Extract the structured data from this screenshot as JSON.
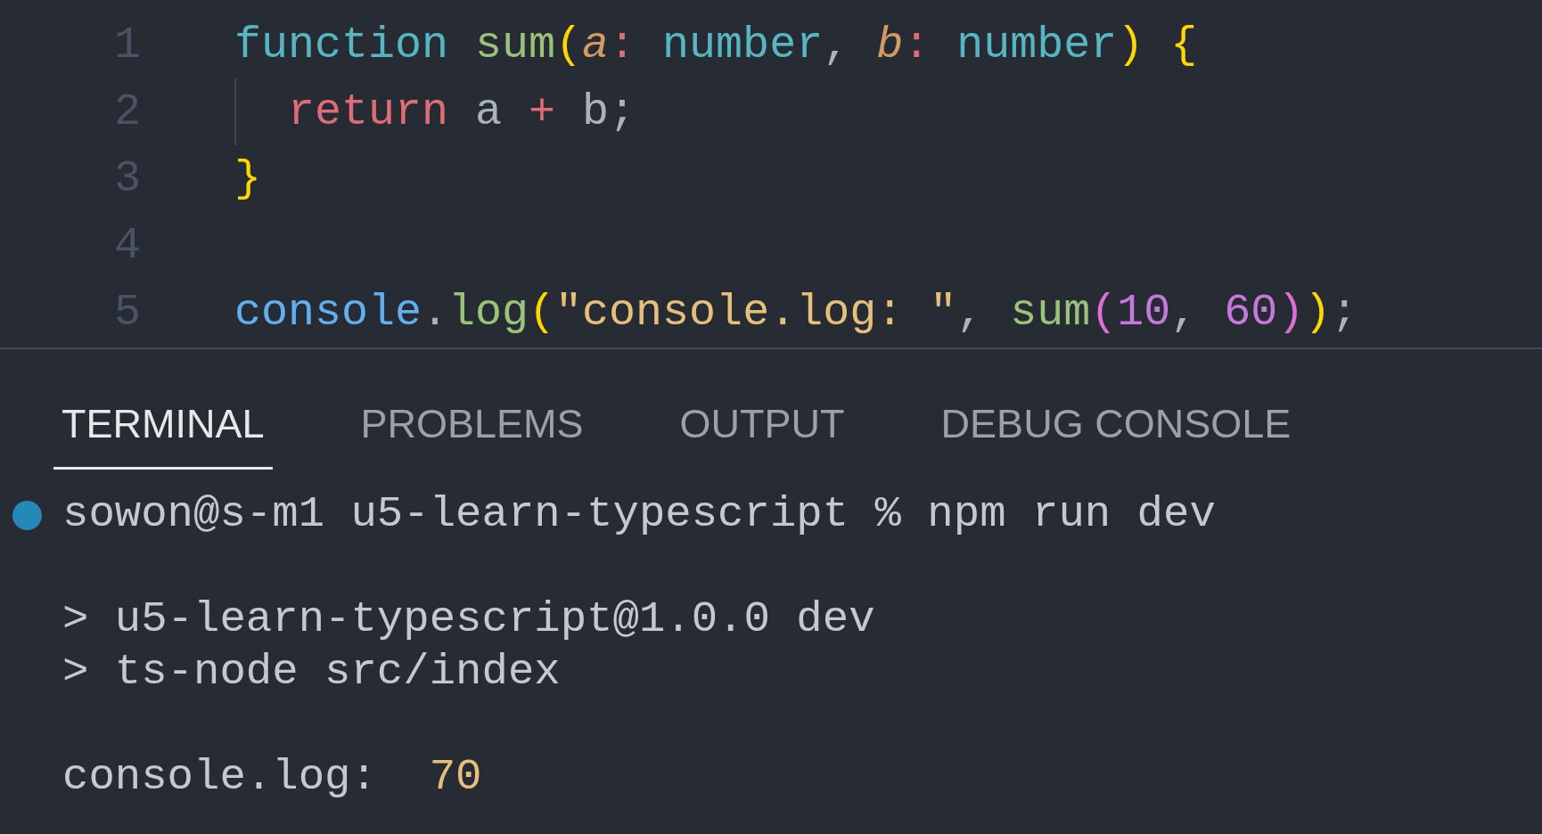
{
  "editor": {
    "lines": [
      {
        "number": "1",
        "indent_guide": false,
        "tokens": [
          {
            "text": "function ",
            "kind": "keyword"
          },
          {
            "text": "sum",
            "kind": "function"
          },
          {
            "text": "(",
            "kind": "bracket"
          },
          {
            "text": "a",
            "kind": "param"
          },
          {
            "text": ": ",
            "kind": "operator"
          },
          {
            "text": "number",
            "kind": "type"
          },
          {
            "text": ", ",
            "kind": "plain"
          },
          {
            "text": "b",
            "kind": "param"
          },
          {
            "text": ": ",
            "kind": "operator"
          },
          {
            "text": "number",
            "kind": "type"
          },
          {
            "text": ") ",
            "kind": "bracket"
          },
          {
            "text": "{",
            "kind": "bracket"
          }
        ]
      },
      {
        "number": "2",
        "indent_guide": true,
        "tokens": [
          {
            "text": "return",
            "kind": "control"
          },
          {
            "text": " a ",
            "kind": "plain"
          },
          {
            "text": "+",
            "kind": "operator"
          },
          {
            "text": " b;",
            "kind": "plain"
          }
        ]
      },
      {
        "number": "3",
        "indent_guide": false,
        "tokens": [
          {
            "text": "}",
            "kind": "bracket"
          }
        ]
      },
      {
        "number": "4",
        "indent_guide": false
      },
      {
        "number": "5",
        "indent_guide": false,
        "tokens": [
          {
            "text": "console",
            "kind": "object"
          },
          {
            "text": ".",
            "kind": "plain"
          },
          {
            "text": "log",
            "kind": "function"
          },
          {
            "text": "(",
            "kind": "bracket"
          },
          {
            "text": "\"console.log: \"",
            "kind": "string"
          },
          {
            "text": ", ",
            "kind": "plain"
          },
          {
            "text": "sum",
            "kind": "function"
          },
          {
            "text": "(",
            "kind": "bracket2"
          },
          {
            "text": "10",
            "kind": "number"
          },
          {
            "text": ", ",
            "kind": "plain"
          },
          {
            "text": "60",
            "kind": "number"
          },
          {
            "text": ")",
            "kind": "bracket2"
          },
          {
            "text": ")",
            "kind": "bracket"
          },
          {
            "text": ";",
            "kind": "plain"
          }
        ]
      }
    ]
  },
  "panel": {
    "tabs": [
      {
        "label": "TERMINAL",
        "selected": true
      },
      {
        "label": "PROBLEMS",
        "selected": false
      },
      {
        "label": "OUTPUT",
        "selected": false
      },
      {
        "label": "DEBUG CONSOLE",
        "selected": false
      }
    ],
    "terminal": {
      "groups": [
        [
          {
            "kind": "prompt",
            "text": "sowon@s-m1 u5-learn-typescript % npm run dev",
            "color": "#2489b8"
          }
        ],
        [
          {
            "kind": "output",
            "text": "> u5-learn-typescript@1.0.0 dev"
          },
          {
            "kind": "output",
            "text": "> ts-node src/index"
          }
        ],
        [
          {
            "kind": "result",
            "label": "console.log: ",
            "value": "70"
          }
        ]
      ]
    }
  }
}
